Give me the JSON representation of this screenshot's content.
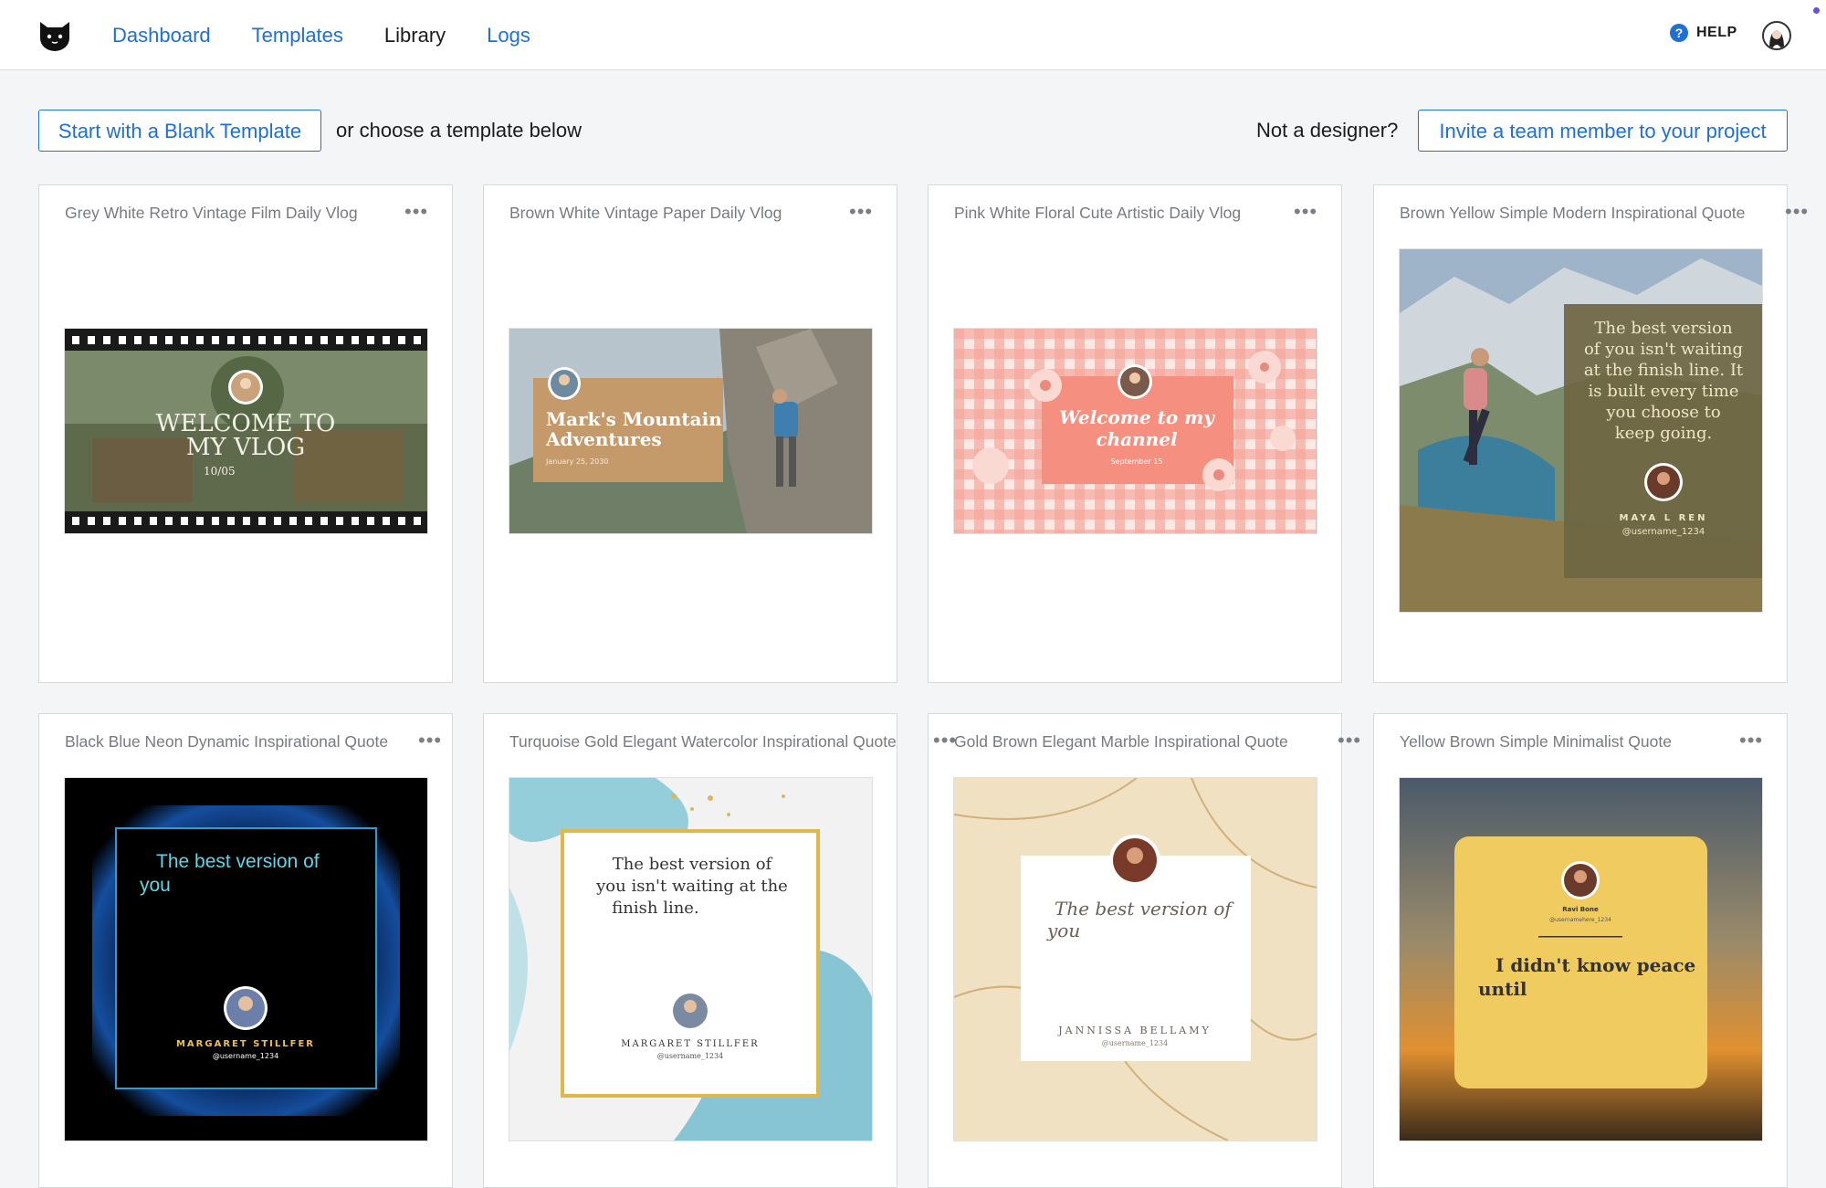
{
  "nav": {
    "items": [
      "Dashboard",
      "Templates",
      "Library",
      "Logs"
    ],
    "active": "Library"
  },
  "header": {
    "help_label": "HELP"
  },
  "actions": {
    "blank_template": "Start with a Blank Template",
    "choose_text": "or choose a template below",
    "not_designer": "Not a designer?",
    "invite": "Invite a team member to your project"
  },
  "templates": [
    {
      "title": "Grey White Retro Vintage Film Daily Vlog",
      "thumb": {
        "line1": "WELCOME TO",
        "line2": "MY VLOG",
        "date": "10/05"
      }
    },
    {
      "title": "Brown White Vintage Paper Daily Vlog",
      "thumb": {
        "line1": "Mark's Mountain",
        "line2": "Adventures",
        "date": "January 25, 2030"
      }
    },
    {
      "title": "Pink White Floral Cute Artistic Daily Vlog",
      "thumb": {
        "line1": "Welcome to my",
        "line2": "channel",
        "date": "September 15"
      }
    },
    {
      "title": "Brown Yellow Simple Modern Inspirational Quote",
      "thumb": {
        "quote": [
          "The best version",
          "of you isn't waiting",
          "at the finish line. It",
          "is built every time",
          "you choose to",
          "keep going."
        ],
        "name": "MAYA L REN",
        "handle": "@username_1234"
      }
    },
    {
      "title": "Black Blue Neon Dynamic Inspirational Quote",
      "thumb": {
        "quote": [
          "The best version of",
          "you"
        ],
        "name": "MARGARET STILLFER",
        "handle": "@username_1234"
      }
    },
    {
      "title": "Turquoise Gold Elegant Watercolor Inspirational Quote",
      "thumb": {
        "quote": [
          "The best version of",
          "you isn't waiting at the",
          "finish line."
        ],
        "name": "MARGARET STILLFER",
        "handle": "@username_1234"
      }
    },
    {
      "title": "Gold Brown Elegant Marble Inspirational Quote",
      "thumb": {
        "quote": [
          "The best version of",
          "you"
        ],
        "name": "JANNISSA BELLAMY",
        "handle": "@username_1234"
      }
    },
    {
      "title": "Yellow Brown Simple Minimalist Quote",
      "thumb": {
        "quote": [
          "I didn't know peace",
          "until"
        ],
        "name": "Ravi Bone",
        "handle": "@usernamehere_1234"
      }
    }
  ],
  "colors": {
    "accent": "#1e6fd8",
    "card_border": "#d6d8dc",
    "background": "#f4f5f7"
  },
  "icons": {
    "logo": "cat-logo-icon",
    "help": "question-circle-icon",
    "more": "more-dots-icon",
    "avatar": "user-avatar-icon"
  }
}
